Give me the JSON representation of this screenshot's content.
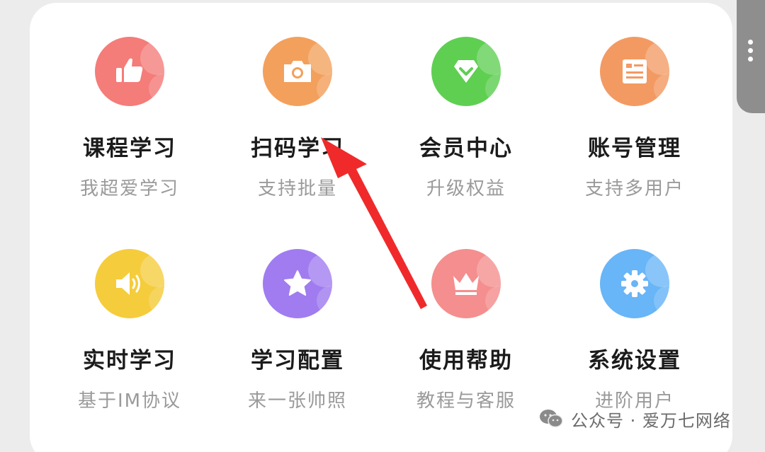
{
  "menu": {
    "items": [
      {
        "title": "课程学习",
        "subtitle": "我超爱学习",
        "icon": "thumbs-up-icon",
        "color": "#f47c79"
      },
      {
        "title": "扫码学习",
        "subtitle": "支持批量",
        "icon": "camera-icon",
        "color": "#f3a05c"
      },
      {
        "title": "会员中心",
        "subtitle": "升级权益",
        "icon": "diamond-icon",
        "color": "#5fcf52"
      },
      {
        "title": "账号管理",
        "subtitle": "支持多用户",
        "icon": "id-card-icon",
        "color": "#f39a63"
      },
      {
        "title": "实时学习",
        "subtitle": "基于IM协议",
        "icon": "speaker-icon",
        "color": "#f5cc3c"
      },
      {
        "title": "学习配置",
        "subtitle": "来一张帅照",
        "icon": "star-icon",
        "color": "#a07cf0"
      },
      {
        "title": "使用帮助",
        "subtitle": "教程与客服",
        "icon": "crown-icon",
        "color": "#f58e8e"
      },
      {
        "title": "系统设置",
        "subtitle": "进阶用户",
        "icon": "gear-icon",
        "color": "#68b5f7"
      }
    ]
  },
  "annotation": {
    "arrow_color": "#f02a2a",
    "arrow_icon": "red-arrow-icon"
  },
  "watermark": {
    "text": "公众号 · 爱万七网络",
    "icon": "wechat-icon"
  }
}
